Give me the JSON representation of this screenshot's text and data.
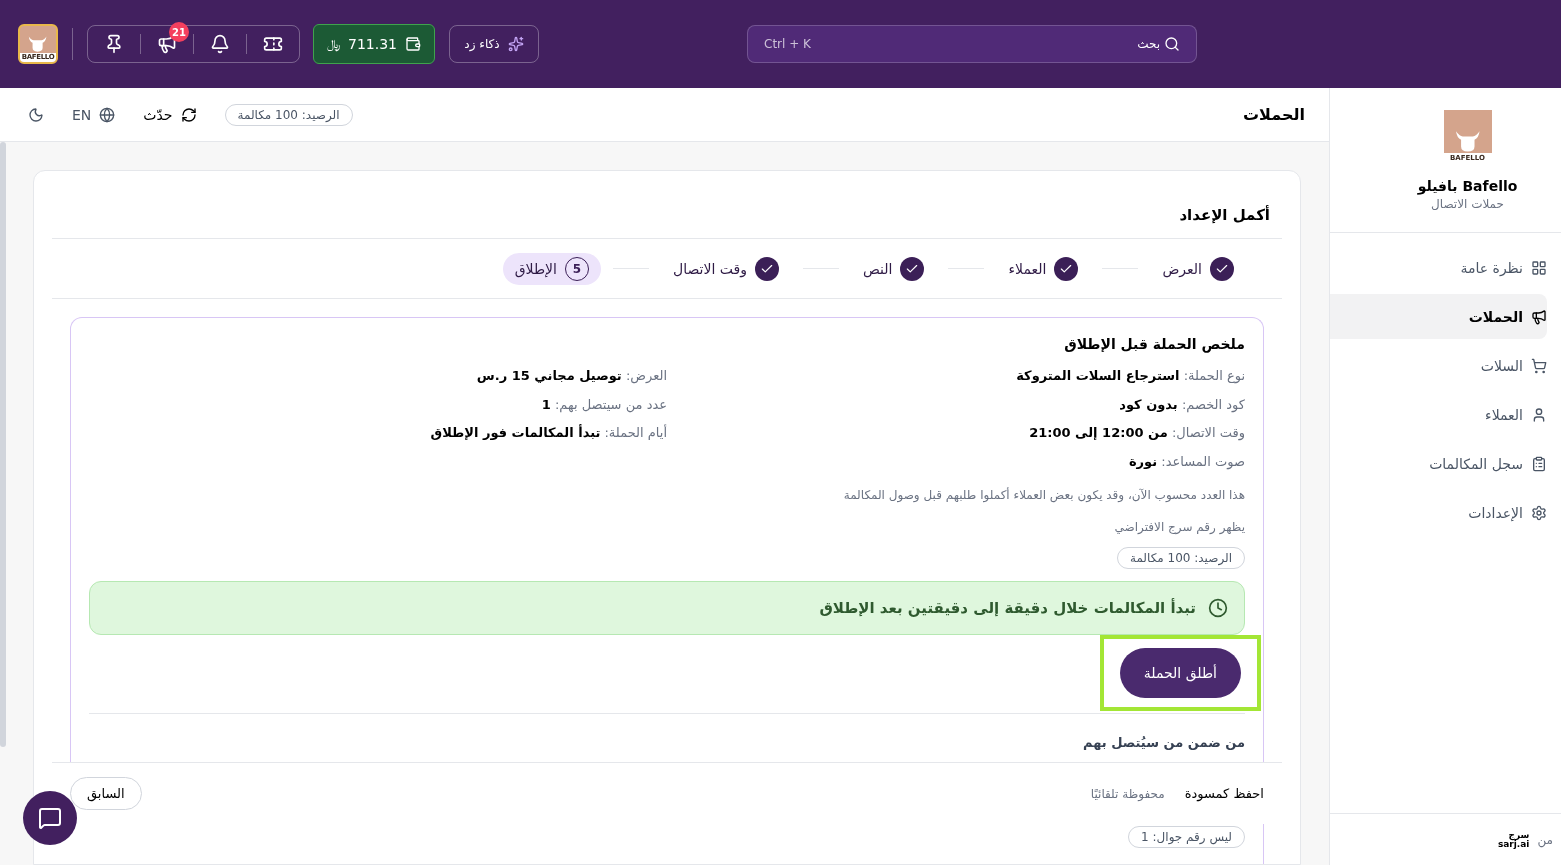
{
  "topbar": {
    "logo_text": "BAFELLO",
    "notifications_badge": "21",
    "wallet_amount": "711.31",
    "currency": "﷼",
    "ai_button": "ذكاء زد",
    "search": {
      "label": "بحث",
      "shortcut": "Ctrl + K"
    }
  },
  "header": {
    "title": "الحملات",
    "balance": "الرصيد: 100 مكالمة",
    "refresh": "حدّث",
    "language": "EN"
  },
  "setup": {
    "title": "أكمل الإعداد",
    "steps": [
      {
        "label": "العرض",
        "done": true,
        "selected": false
      },
      {
        "label": "العملاء",
        "done": true,
        "selected": false
      },
      {
        "label": "النص",
        "done": true,
        "selected": false
      },
      {
        "label": "وقت الاتصال",
        "done": true,
        "selected": false
      },
      {
        "label": "الإطلاق",
        "done": false,
        "selected": true,
        "number": "5"
      }
    ],
    "summary": {
      "title": "ملخص الحملة قبل الإطلاق",
      "right_fields": [
        {
          "label": "نوع الحملة:",
          "value": "استرجاع السلات المتروكة"
        },
        {
          "label": "كود الخصم:",
          "value": "بدون كود"
        },
        {
          "label": "وقت الاتصال:",
          "value": "من 12:00 إلى 21:00"
        },
        {
          "label": "صوت المساعد:",
          "value": "نورة"
        }
      ],
      "left_fields": [
        {
          "label": "العرض:",
          "value": "توصيل مجاني 15 ر.س"
        },
        {
          "label": "عدد من سيتصل بهم:",
          "value": "1"
        },
        {
          "label": "أيام الحملة:",
          "value": "تبدأ المكالمات فور الإطلاق"
        }
      ],
      "notes": [
        "هذا العدد محسوب الآن، وقد يكون بعض العملاء أكملوا طلبهم قبل وصول المكالمة",
        "يظهر رقم سرج الافتراضي"
      ],
      "balance": "الرصيد: 100 مكالمة",
      "banner": "تبدأ المكالمات خلال دقيقة إلى دقيقتين بعد الإطلاق",
      "launch_button": "أطلق الحملة",
      "recipients_title": "من ضمن من سيُتصل بهم",
      "not_mobile": "ليس رقم جوال: 1"
    },
    "footer": {
      "save_draft": "احفظ كمسودة",
      "autosaved": "محفوظة تلقائيًا",
      "previous": "السابق"
    }
  },
  "sidebar": {
    "logo_text": "BAFELLO",
    "name": "Bafello بافيلو",
    "subtitle": "حملات الاتصال",
    "items": [
      {
        "label": "نظرة عامة",
        "selected": false
      },
      {
        "label": "الحملات",
        "selected": true
      },
      {
        "label": "السلات",
        "selected": false
      },
      {
        "label": "العملاء",
        "selected": false
      },
      {
        "label": "سجل المكالمات",
        "selected": false
      },
      {
        "label": "الإعدادات",
        "selected": false
      }
    ],
    "footer_text": "من",
    "footer_logo_ar": "سرج",
    "footer_logo_en": "sarj.ai"
  }
}
